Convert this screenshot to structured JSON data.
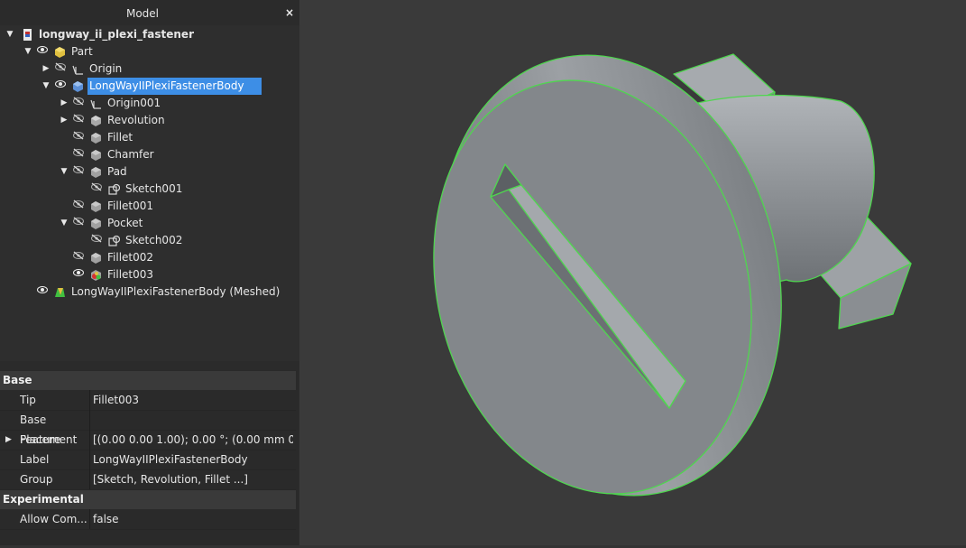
{
  "panel": {
    "title": "Model",
    "close_label": "×"
  },
  "tree": [
    {
      "label": "longway_ii_plexi_fastener",
      "icon": "document-icon",
      "expand": "open",
      "eye": "none",
      "bold": true
    },
    {
      "label": "Part",
      "icon": "part-icon",
      "expand": "open",
      "eye": "visible"
    },
    {
      "label": "Origin",
      "icon": "origin-icon",
      "expand": "closed",
      "eye": "hidden"
    },
    {
      "label": "LongWayIIPlexiFastenerBody",
      "icon": "body-icon",
      "expand": "open",
      "eye": "visible",
      "selected": true
    },
    {
      "label": "Origin001",
      "icon": "origin-icon",
      "expand": "closed",
      "eye": "hidden"
    },
    {
      "label": "Revolution",
      "icon": "revolution-icon",
      "expand": "closed",
      "eye": "hidden"
    },
    {
      "label": "Fillet",
      "icon": "fillet-icon",
      "expand": "none",
      "eye": "hidden"
    },
    {
      "label": "Chamfer",
      "icon": "chamfer-icon",
      "expand": "none",
      "eye": "hidden"
    },
    {
      "label": "Pad",
      "icon": "pad-icon",
      "expand": "open",
      "eye": "hidden"
    },
    {
      "label": "Sketch001",
      "icon": "sketch-icon",
      "expand": "none",
      "eye": "hidden"
    },
    {
      "label": "Fillet001",
      "icon": "fillet-icon",
      "expand": "none",
      "eye": "hidden"
    },
    {
      "label": "Pocket",
      "icon": "pocket-icon",
      "expand": "open",
      "eye": "hidden"
    },
    {
      "label": "Sketch002",
      "icon": "sketch-icon",
      "expand": "none",
      "eye": "hidden"
    },
    {
      "label": "Fillet002",
      "icon": "fillet-icon",
      "expand": "none",
      "eye": "hidden"
    },
    {
      "label": "Fillet003",
      "icon": "fillet-tip-icon",
      "expand": "none",
      "eye": "visible"
    },
    {
      "label": "LongWayIIPlexiFastenerBody (Meshed)",
      "icon": "mesh-icon",
      "expand": "none",
      "eye": "visible"
    }
  ],
  "properties": {
    "groups": [
      {
        "name": "Base",
        "rows": [
          {
            "name": "Tip",
            "value": "Fillet003"
          },
          {
            "name": "Base Feature",
            "value": ""
          },
          {
            "name": "Placement",
            "value": "[(0.00 0.00 1.00); 0.00 °; (0.00 mm  0.0...",
            "expandable": true
          },
          {
            "name": "Label",
            "value": "LongWayIIPlexiFastenerBody"
          },
          {
            "name": "Group",
            "value": "[Sketch, Revolution, Fillet ...]"
          }
        ]
      },
      {
        "name": "Experimental",
        "rows": [
          {
            "name": "Allow Com...",
            "value": "false"
          }
        ]
      }
    ]
  },
  "colors": {
    "selection": "#3d8ee6",
    "edge": "#4fd64f",
    "model_face": "#8a8e92",
    "background": "#3a3a3a"
  }
}
